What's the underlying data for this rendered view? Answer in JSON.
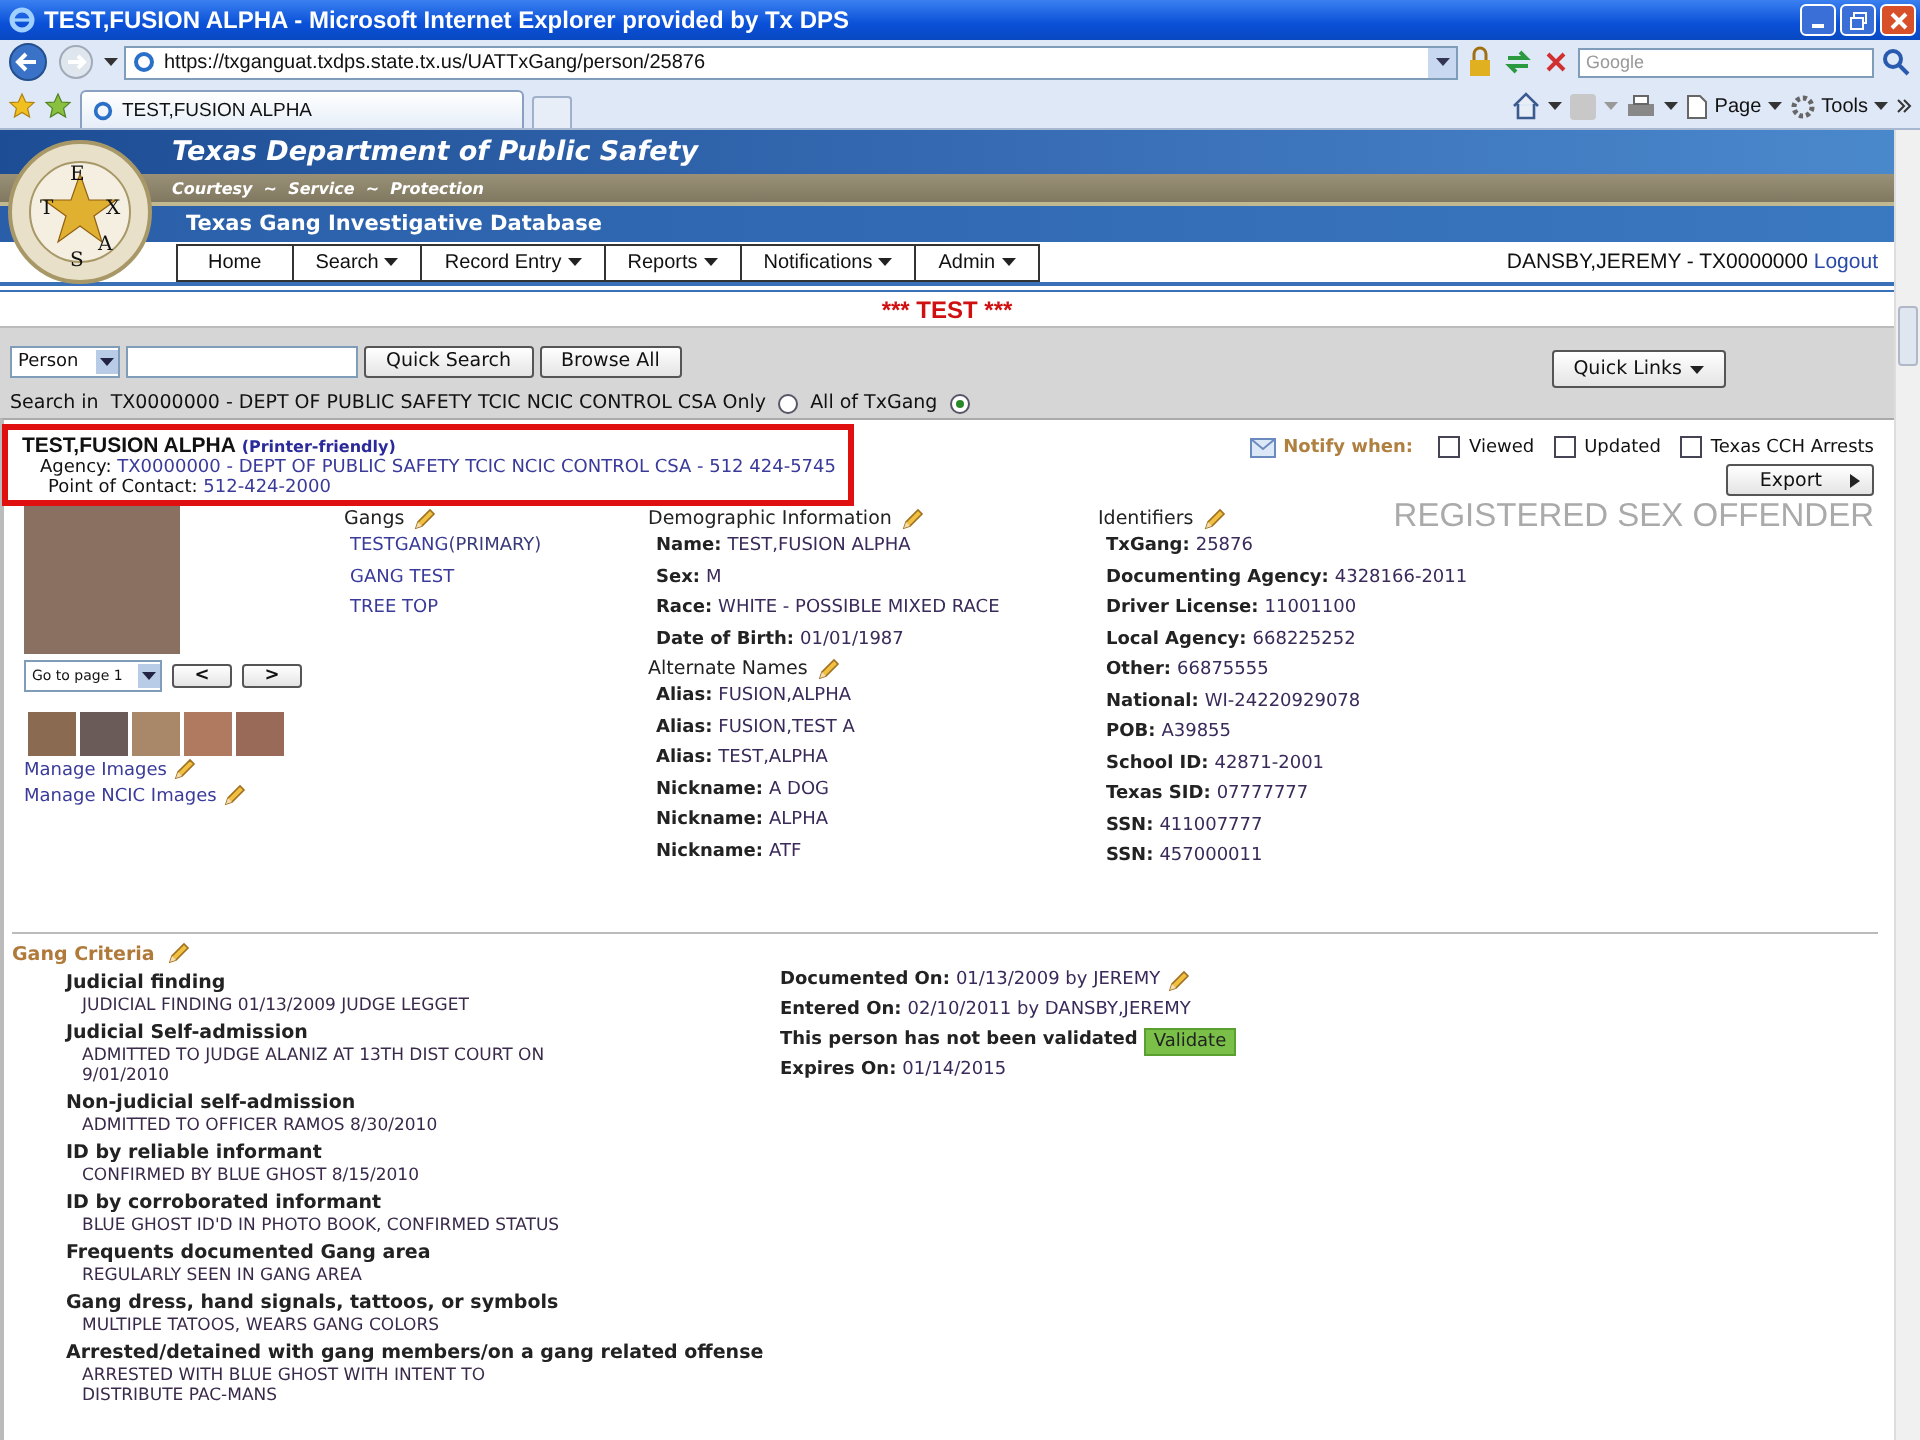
{
  "browser": {
    "title": "TEST,FUSION ALPHA - Microsoft Internet Explorer provided by Tx DPS",
    "url": "https://txganguat.txdps.state.tx.us/UATTxGang/person/25876",
    "search_placeholder": "Google",
    "tab_title": "TEST,FUSION ALPHA",
    "toolbar": [
      "Page",
      "Tools"
    ]
  },
  "header": {
    "logo_letters": [
      "T",
      "E",
      "X",
      "A",
      "S"
    ],
    "title": "Texas Department of Public Safety",
    "motto": "Courtesy  ~  Service  ~  Protection",
    "database": "Texas Gang Investigative Database",
    "nav": [
      {
        "label": "Home",
        "has_menu": false
      },
      {
        "label": "Search",
        "has_menu": true
      },
      {
        "label": "Record Entry",
        "has_menu": true
      },
      {
        "label": "Reports",
        "has_menu": true
      },
      {
        "label": "Notifications",
        "has_menu": true
      },
      {
        "label": "Admin",
        "has_menu": true
      }
    ],
    "user": "DANSBY,JEREMY - TX0000000",
    "logout": "Logout"
  },
  "banner": "*** TEST ***",
  "search": {
    "type": "Person",
    "quick_search": "Quick Search",
    "browse_all": "Browse All",
    "quick_links": "Quick Links",
    "scope_prefix": "Search in",
    "options": [
      {
        "label": "TX0000000 - DEPT OF PUBLIC SAFETY TCIC NCIC CONTROL CSA Only",
        "selected": false
      },
      {
        "label": "All of TxGang",
        "selected": true
      }
    ]
  },
  "person": {
    "name": "TEST,FUSION ALPHA",
    "printer_link": "(Printer-friendly)",
    "agency_label": "Agency:",
    "agency": "TX0000000 - DEPT OF PUBLIC SAFETY TCIC NCIC CONTROL CSA - 512 424-5745",
    "contact_label": "Point of Contact:",
    "contact": "512-424-2000",
    "highlighted": true
  },
  "notify": {
    "label": "Notify when:",
    "options": [
      {
        "label": "Viewed",
        "checked": false
      },
      {
        "label": "Updated",
        "checked": false
      },
      {
        "label": "Texas CCH Arrests",
        "checked": false
      }
    ]
  },
  "export": "Export",
  "status_banner": "REGISTERED SEX OFFENDER",
  "images": {
    "page_select": "Go to page 1",
    "prev": "<",
    "next": ">",
    "links": [
      "Manage Images",
      "Manage NCIC Images"
    ]
  },
  "gangs": {
    "title": "Gangs",
    "items": [
      {
        "name": "TESTGANG",
        "note": "(PRIMARY)"
      },
      {
        "name": "GANG TEST"
      },
      {
        "name": "TREE TOP"
      }
    ]
  },
  "demographics": {
    "title": "Demographic Information",
    "fields": [
      {
        "label": "Name:",
        "value": "TEST,FUSION ALPHA"
      },
      {
        "label": "Sex:",
        "value": "M"
      },
      {
        "label": "Race:",
        "value": "WHITE - POSSIBLE MIXED RACE"
      },
      {
        "label": "Date of Birth:",
        "value": "01/01/1987"
      }
    ]
  },
  "alternate_names": {
    "title": "Alternate Names",
    "fields": [
      {
        "label": "Alias:",
        "value": "FUSION,ALPHA"
      },
      {
        "label": "Alias:",
        "value": "FUSION,TEST A"
      },
      {
        "label": "Alias:",
        "value": "TEST,ALPHA"
      },
      {
        "label": "Nickname:",
        "value": "A DOG"
      },
      {
        "label": "Nickname:",
        "value": "ALPHA"
      },
      {
        "label": "Nickname:",
        "value": "ATF"
      }
    ]
  },
  "identifiers": {
    "title": "Identifiers",
    "fields": [
      {
        "label": "TxGang:",
        "value": "25876"
      },
      {
        "label": "Documenting Agency:",
        "value": "4328166-2011"
      },
      {
        "label": "Driver License:",
        "value": "11001100"
      },
      {
        "label": "Local Agency:",
        "value": "668225252"
      },
      {
        "label": "Other:",
        "value": "66875555"
      },
      {
        "label": "National:",
        "value": "WI-24220929078"
      },
      {
        "label": "POB:",
        "value": "A39855"
      },
      {
        "label": "School ID:",
        "value": "42871-2001"
      },
      {
        "label": "Texas SID:",
        "value": "07777777"
      },
      {
        "label": "SSN:",
        "value": "411007777"
      },
      {
        "label": "SSN:",
        "value": "457000011"
      }
    ]
  },
  "gang_criteria": {
    "title": "Gang Criteria",
    "items": [
      {
        "title": "Judicial finding",
        "detail": "JUDICIAL FINDING 01/13/2009 JUDGE LEGGET"
      },
      {
        "title": "Judicial Self-admission",
        "detail": "ADMITTED TO JUDGE ALANIZ AT 13TH DIST COURT ON 9/01/2010"
      },
      {
        "title": "Non-judicial self-admission",
        "detail": "ADMITTED TO OFFICER RAMOS 8/30/2010"
      },
      {
        "title": "ID by reliable informant",
        "detail": "CONFIRMED BY BLUE GHOST 8/15/2010"
      },
      {
        "title": "ID by corroborated informant",
        "detail": "BLUE GHOST ID'D IN PHOTO BOOK, CONFIRMED STATUS"
      },
      {
        "title": "Frequents documented Gang area",
        "detail": "REGULARLY SEEN IN GANG AREA"
      },
      {
        "title": "Gang dress, hand signals, tattoos, or symbols",
        "detail": "MULTIPLE TATOOS, WEARS GANG COLORS"
      },
      {
        "title": "Arrested/detained with gang members/on a gang related offense",
        "detail": "ARRESTED WITH BLUE GHOST WITH INTENT TO DISTRIBUTE PAC-MANS"
      }
    ],
    "status": [
      {
        "label": "Documented On:",
        "value": "01/13/2009 by JEREMY",
        "editable": true
      },
      {
        "label": "Entered On:",
        "value": "02/10/2011 by DANSBY,JEREMY",
        "editable": false
      }
    ],
    "validation": {
      "text": "This person has not been validated",
      "button": "Validate",
      "validated": false
    },
    "expires": {
      "label": "Expires On:",
      "value": "01/14/2015"
    }
  }
}
